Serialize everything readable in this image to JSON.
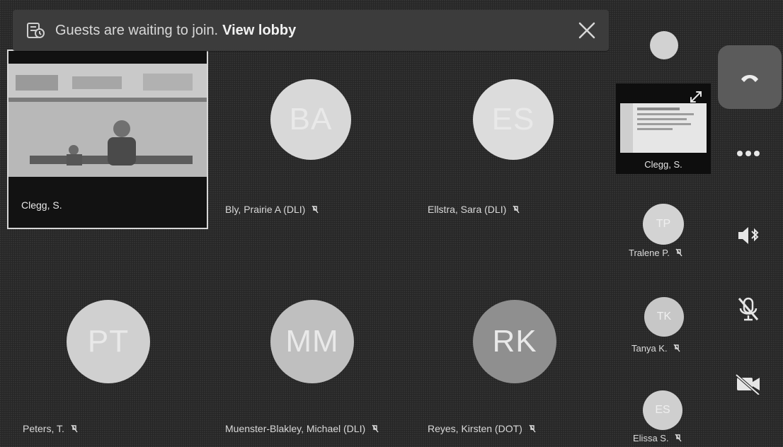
{
  "banner": {
    "message": "Guests are waiting to join.",
    "link_label": "View lobby"
  },
  "video_tile": {
    "name": "Clegg, S."
  },
  "participants": [
    {
      "initials": "BA",
      "label": "Bly, Prairie A (DLI)",
      "muted": true,
      "color": "#d8d8d8"
    },
    {
      "initials": "ES",
      "label": "Ellstra, Sara (DLI)",
      "muted": true,
      "color": "#dcdcdc"
    },
    {
      "initials": "PT",
      "label": "Peters, T.",
      "muted": true,
      "color": "#d0d0d0"
    },
    {
      "initials": "MM",
      "label": "Muenster-Blakley, Michael (DLI)",
      "muted": true,
      "color": "#bfbfbf"
    },
    {
      "initials": "RK",
      "label": "Reyes, Kirsten (DOT)",
      "muted": true,
      "color": "#8f8f8f"
    }
  ],
  "sidebar": {
    "share": {
      "name": "Clegg, S."
    },
    "people": [
      {
        "initials": "TP",
        "label": "Tralene P.",
        "muted": true,
        "color": "#d3d3d3"
      },
      {
        "initials": "TK",
        "label": "Tanya K.",
        "muted": true,
        "color": "#c7c7c7"
      },
      {
        "initials": "ES",
        "label": "Elissa S.",
        "muted": true,
        "color": "#cfcfcf"
      }
    ]
  },
  "controls": {
    "hangup": "phone-hangup-icon",
    "more": "more-icon",
    "speaker": "speaker-bluetooth-icon",
    "mute": "mic-muted-icon",
    "video": "camera-off-icon"
  }
}
